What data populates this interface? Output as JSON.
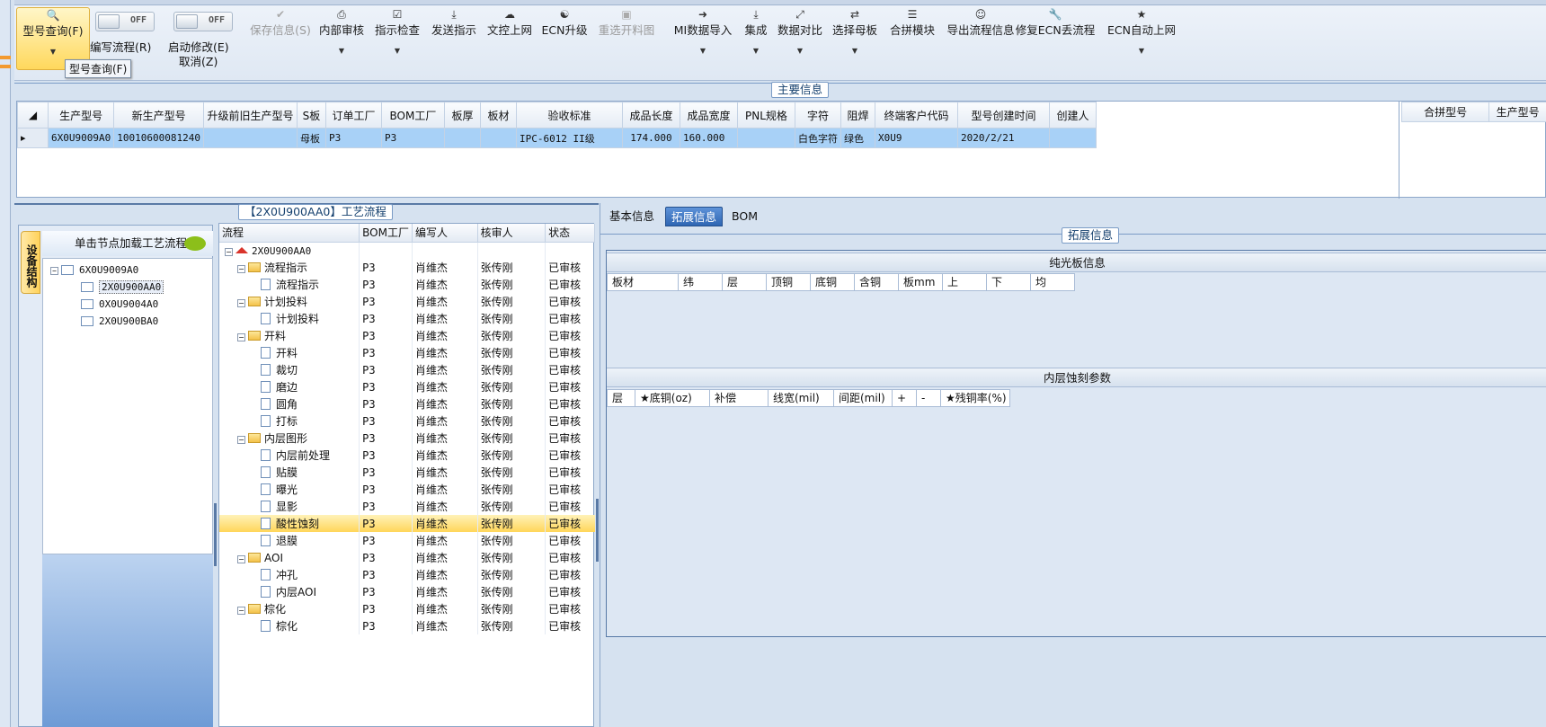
{
  "toolbar": {
    "items": [
      {
        "icon": "search-icon",
        "label": "型号查询(F)"
      },
      {
        "label": "编写流程(R)",
        "toggle": "OFF"
      },
      {
        "label": "启动修改(E)",
        "sub": "取消(Z)",
        "toggle": "OFF"
      },
      {
        "icon": "check-icon",
        "label": "保存信息(S)"
      },
      {
        "icon": "printer-icon",
        "label": "内部审核"
      },
      {
        "icon": "checkbox-icon",
        "label": "指示检查"
      },
      {
        "icon": "upload-icon",
        "label": "发送指示"
      },
      {
        "icon": "cloud-upload-icon",
        "label": "文控上网"
      },
      {
        "icon": "users-icon",
        "label": "ECN升级"
      },
      {
        "icon": "image-icon",
        "label": "重选开料图"
      },
      {
        "icon": "import-icon",
        "label": "MI数据导入"
      },
      {
        "icon": "download-icon",
        "label": "集成"
      },
      {
        "icon": "compress-icon",
        "label": "数据对比"
      },
      {
        "icon": "shuffle-icon",
        "label": "选择母板"
      },
      {
        "icon": "list-icon",
        "label": "合拼模块"
      },
      {
        "icon": "smile-icon",
        "label": "导出流程信息"
      },
      {
        "icon": "wrench-icon",
        "label": "修复ECN丢流程"
      },
      {
        "icon": "star-icon",
        "label": "ECN自动上网"
      }
    ],
    "tooltip": "型号查询(F)"
  },
  "main_info": {
    "title": "主要信息",
    "columns": [
      "生产型号",
      "新生产型号",
      "升级前旧生产型号",
      "S板",
      "订单工厂",
      "BOM工厂",
      "板厚",
      "板材",
      "验收标准",
      "成品长度",
      "成品宽度",
      "PNL规格",
      "字符",
      "阻焊",
      "终端客户代码",
      "型号创建时间",
      "创建人"
    ],
    "row": [
      "6X0U9009A0",
      "10010600081240",
      "",
      "母板",
      "P3",
      "P3",
      "",
      "",
      "IPC-6012 II级",
      "174.000",
      "160.000",
      "",
      "白色字符",
      "绿色",
      "X0U9",
      "2020/2/21",
      ""
    ],
    "side_columns": [
      "合拼型号",
      "生产型号"
    ]
  },
  "left_tree": {
    "vtab": "设备结构",
    "header": "单击节点加载工艺流程",
    "nodes": [
      {
        "label": "6X0U9009A0",
        "level": 0
      },
      {
        "label": "2X0U900AA0",
        "level": 1,
        "selected": true
      },
      {
        "label": "0X0U9004A0",
        "level": 1
      },
      {
        "label": "2X0U900BA0",
        "level": 1
      }
    ]
  },
  "process": {
    "title": "【2X0U900AA0】工艺流程",
    "columns": [
      "流程",
      "BOM工厂",
      "编写人",
      "核审人",
      "状态"
    ],
    "root": "2X0U900AA0",
    "rows": [
      {
        "name": "流程指示",
        "type": "folder",
        "bom": "P3",
        "writer": "肖维杰",
        "reviewer": "张传刚",
        "status": "已审核"
      },
      {
        "name": "流程指示",
        "type": "doc",
        "bom": "P3",
        "writer": "肖维杰",
        "reviewer": "张传刚",
        "status": "已审核"
      },
      {
        "name": "计划投料",
        "type": "folder",
        "bom": "P3",
        "writer": "肖维杰",
        "reviewer": "张传刚",
        "status": "已审核"
      },
      {
        "name": "计划投料",
        "type": "doc",
        "bom": "P3",
        "writer": "肖维杰",
        "reviewer": "张传刚",
        "status": "已审核"
      },
      {
        "name": "开料",
        "type": "folder",
        "bom": "P3",
        "writer": "肖维杰",
        "reviewer": "张传刚",
        "status": "已审核"
      },
      {
        "name": "开料",
        "type": "doc",
        "bom": "P3",
        "writer": "肖维杰",
        "reviewer": "张传刚",
        "status": "已审核"
      },
      {
        "name": "裁切",
        "type": "doc",
        "bom": "P3",
        "writer": "肖维杰",
        "reviewer": "张传刚",
        "status": "已审核"
      },
      {
        "name": "磨边",
        "type": "doc",
        "bom": "P3",
        "writer": "肖维杰",
        "reviewer": "张传刚",
        "status": "已审核"
      },
      {
        "name": "圆角",
        "type": "doc",
        "bom": "P3",
        "writer": "肖维杰",
        "reviewer": "张传刚",
        "status": "已审核"
      },
      {
        "name": "打标",
        "type": "doc",
        "bom": "P3",
        "writer": "肖维杰",
        "reviewer": "张传刚",
        "status": "已审核"
      },
      {
        "name": "内层图形",
        "type": "folder",
        "bom": "P3",
        "writer": "肖维杰",
        "reviewer": "张传刚",
        "status": "已审核"
      },
      {
        "name": "内层前处理",
        "type": "doc",
        "bom": "P3",
        "writer": "肖维杰",
        "reviewer": "张传刚",
        "status": "已审核"
      },
      {
        "name": "贴膜",
        "type": "doc",
        "bom": "P3",
        "writer": "肖维杰",
        "reviewer": "张传刚",
        "status": "已审核"
      },
      {
        "name": "曝光",
        "type": "doc",
        "bom": "P3",
        "writer": "肖维杰",
        "reviewer": "张传刚",
        "status": "已审核"
      },
      {
        "name": "显影",
        "type": "doc",
        "bom": "P3",
        "writer": "肖维杰",
        "reviewer": "张传刚",
        "status": "已审核"
      },
      {
        "name": "酸性蚀刻",
        "type": "doc",
        "bom": "P3",
        "writer": "肖维杰",
        "reviewer": "张传刚",
        "status": "已审核",
        "highlight": true
      },
      {
        "name": "退膜",
        "type": "doc",
        "bom": "P3",
        "writer": "肖维杰",
        "reviewer": "张传刚",
        "status": "已审核"
      },
      {
        "name": "AOI",
        "type": "folder",
        "bom": "P3",
        "writer": "肖维杰",
        "reviewer": "张传刚",
        "status": "已审核"
      },
      {
        "name": "冲孔",
        "type": "doc",
        "bom": "P3",
        "writer": "肖维杰",
        "reviewer": "张传刚",
        "status": "已审核"
      },
      {
        "name": "内层AOI",
        "type": "doc",
        "bom": "P3",
        "writer": "肖维杰",
        "reviewer": "张传刚",
        "status": "已审核"
      },
      {
        "name": "棕化",
        "type": "folder",
        "bom": "P3",
        "writer": "肖维杰",
        "reviewer": "张传刚",
        "status": "已审核"
      },
      {
        "name": "棕化",
        "type": "doc",
        "bom": "P3",
        "writer": "肖维杰",
        "reviewer": "张传刚",
        "status": "已审核"
      }
    ]
  },
  "right": {
    "tabs": [
      "基本信息",
      "拓展信息",
      "BOM"
    ],
    "active_tab": "拓展信息",
    "section_title": "拓展信息",
    "pure_board": {
      "title": "纯光板信息",
      "columns": [
        "板材",
        "纬",
        "层",
        "顶铜",
        "底铜",
        "含铜",
        "板mm",
        "上",
        "下",
        "均"
      ]
    },
    "inner_etch": {
      "title": "内层蚀刻参数",
      "columns": [
        "层",
        "★底铜(oz)",
        "补偿",
        "线宽(mil)",
        "间距(mil)",
        "+",
        "-",
        "★残铜率(%)"
      ]
    }
  },
  "colors": {
    "accent": "#2f66b3",
    "highlight": "#ffd65a",
    "selected_row": "#a8d1f7"
  }
}
